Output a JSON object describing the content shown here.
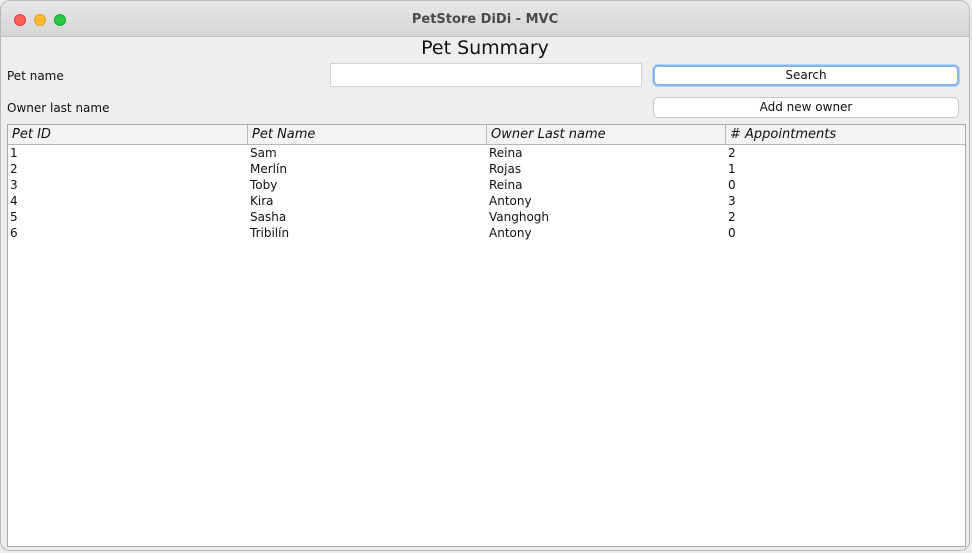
{
  "window": {
    "title": "PetStore DiDi - MVC"
  },
  "page": {
    "title": "Pet Summary"
  },
  "form": {
    "pet_name_label": "Pet name",
    "pet_name_value": "",
    "owner_last_name_label": "Owner last name",
    "search_label": "Search",
    "add_owner_label": "Add new owner"
  },
  "table": {
    "columns": [
      "Pet ID",
      "Pet Name",
      "Owner Last name",
      "# Appointments"
    ],
    "rows": [
      [
        "1",
        "Sam",
        "Reina",
        "2"
      ],
      [
        "2",
        "Merlín",
        "Rojas",
        "1"
      ],
      [
        "3",
        "Toby",
        "Reina",
        "0"
      ],
      [
        "4",
        "Kira",
        "Antony",
        "3"
      ],
      [
        "5",
        "Sasha",
        "Vanghogh",
        "2"
      ],
      [
        "6",
        "Tribilín",
        "Antony",
        "0"
      ]
    ]
  },
  "colors": {
    "close": "#fe5f57",
    "minimize": "#febc2e",
    "maximize": "#28c840",
    "focus_ring": "#8ab4ef"
  }
}
